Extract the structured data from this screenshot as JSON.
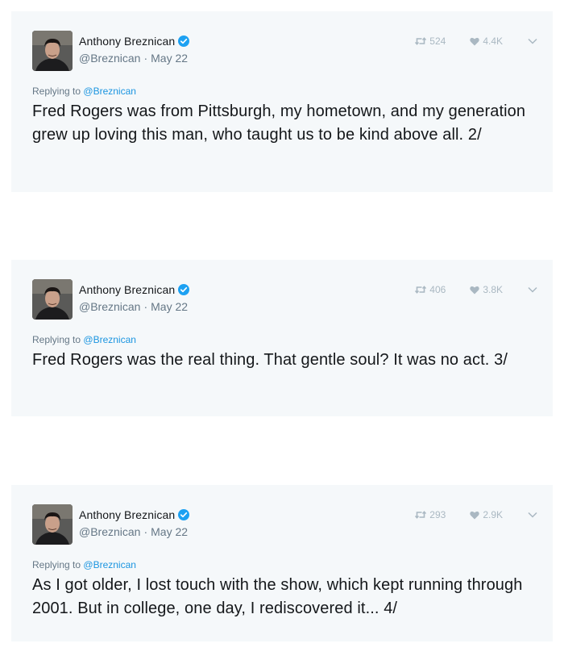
{
  "tweets": [
    {
      "author": "Anthony Breznican",
      "handle": "@Breznican",
      "date": "May 22",
      "retweets": "524",
      "likes": "4.4K",
      "replying_prefix": "Replying to",
      "replying_to": "@Breznican",
      "text": "Fred Rogers was from Pittsburgh, my hometown, and my generation grew up loving this man, who taught us to be kind above all. 2/"
    },
    {
      "author": "Anthony Breznican",
      "handle": "@Breznican",
      "date": "May 22",
      "retweets": "406",
      "likes": "3.8K",
      "replying_prefix": "Replying to",
      "replying_to": "@Breznican",
      "text": "Fred Rogers was the real thing. That gentle soul? It was no act. 3/"
    },
    {
      "author": "Anthony Breznican",
      "handle": "@Breznican",
      "date": "May 22",
      "retweets": "293",
      "likes": "2.9K",
      "replying_prefix": "Replying to",
      "replying_to": "@Breznican",
      "text": "As I got older, I lost touch with the show, which kept running through 2001. But in college, one day, I rediscovered it... 4/"
    }
  ],
  "icons": {
    "verified": "verified-badge-icon",
    "retweet": "retweet-icon",
    "like": "heart-icon",
    "more": "chevron-down-icon"
  },
  "colors": {
    "card_bg": "#f5f8fa",
    "verified": "#1da1f2",
    "link": "#1b95e0",
    "muted": "#657786",
    "stat": "#aab8c2"
  }
}
